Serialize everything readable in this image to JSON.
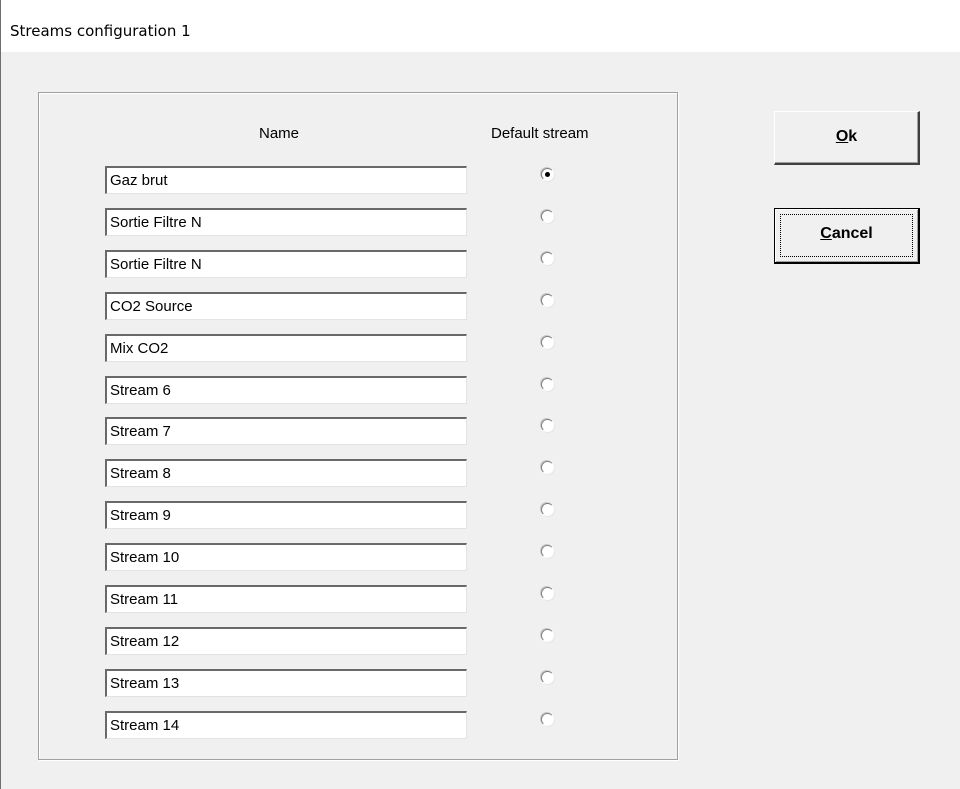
{
  "window": {
    "title": "Streams configuration 1"
  },
  "headers": {
    "name": "Name",
    "default_stream": "Default stream"
  },
  "streams": [
    {
      "name": "Gaz brut",
      "default": true
    },
    {
      "name": "Sortie Filtre N",
      "default": false
    },
    {
      "name": "Sortie Filtre N",
      "default": false
    },
    {
      "name": "CO2 Source",
      "default": false
    },
    {
      "name": "Mix CO2",
      "default": false
    },
    {
      "name": "Stream 6",
      "default": false
    },
    {
      "name": "Stream 7",
      "default": false
    },
    {
      "name": "Stream 8",
      "default": false
    },
    {
      "name": "Stream 9",
      "default": false
    },
    {
      "name": "Stream 10",
      "default": false
    },
    {
      "name": "Stream 11",
      "default": false
    },
    {
      "name": "Stream 12",
      "default": false
    },
    {
      "name": "Stream 13",
      "default": false
    },
    {
      "name": "Stream 14",
      "default": false
    }
  ],
  "buttons": {
    "ok": {
      "mnemonic": "O",
      "rest": "k"
    },
    "cancel": {
      "mnemonic": "C",
      "rest": "ancel"
    }
  }
}
